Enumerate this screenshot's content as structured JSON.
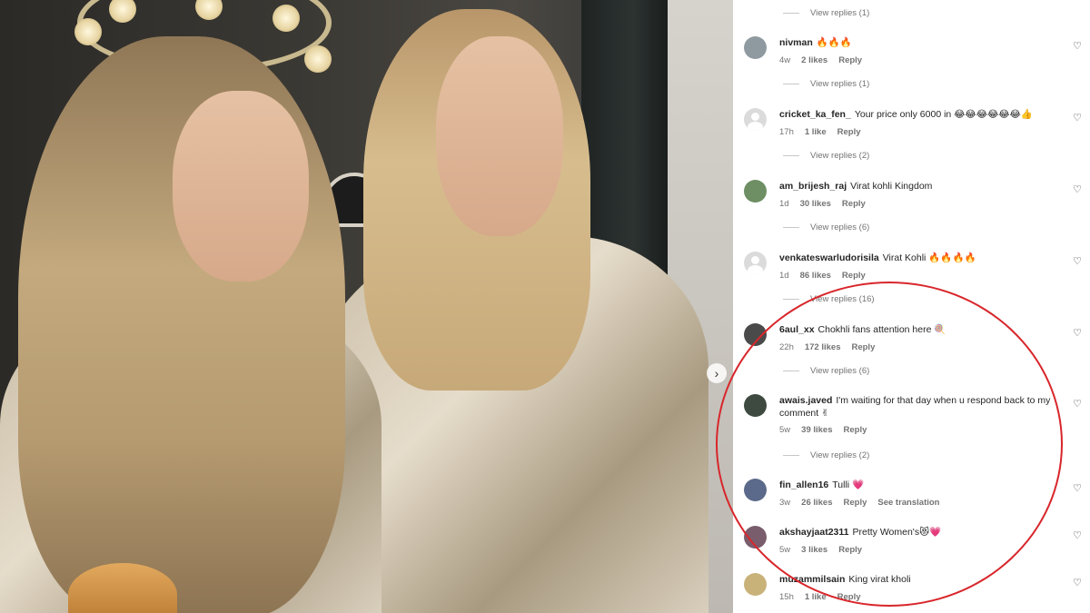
{
  "post": {
    "next_arrow": "›"
  },
  "comments": [
    {
      "type": "view_replies",
      "text": "View replies (1)"
    },
    {
      "username": "nivman",
      "text": "🔥🔥🔥",
      "age": "4w",
      "likes": "2 likes",
      "reply": "Reply",
      "avatar_color": "#8f9aa0"
    },
    {
      "type": "view_replies",
      "text": "View replies (1)"
    },
    {
      "username": "cricket_ka_fen_",
      "text": "Your price only 6000 in 😂😂😂😂😂😂👍",
      "age": "17h",
      "likes": "1 like",
      "reply": "Reply",
      "avatar_color": "generic"
    },
    {
      "type": "view_replies",
      "text": "View replies (2)"
    },
    {
      "username": "am_brijesh_raj",
      "text": "Virat kohli Kingdom",
      "age": "1d",
      "likes": "30 likes",
      "reply": "Reply",
      "avatar_color": "#6d8f63"
    },
    {
      "type": "view_replies",
      "text": "View replies (6)"
    },
    {
      "username": "venkateswarludorisila",
      "text": "Virat Kohli 🔥🔥🔥🔥",
      "age": "1d",
      "likes": "86 likes",
      "reply": "Reply",
      "avatar_color": "generic"
    },
    {
      "type": "view_replies",
      "text": "View replies (16)"
    },
    {
      "username": "6aul_xx",
      "text": "Chokhli fans attention here 🍭",
      "age": "22h",
      "likes": "172 likes",
      "reply": "Reply",
      "avatar_color": "#4a4a4a"
    },
    {
      "type": "view_replies",
      "text": "View replies (6)"
    },
    {
      "username": "awais.javed",
      "text": "I'm waiting for that day when u respond back to my comment ✌",
      "age": "5w",
      "likes": "39 likes",
      "reply": "Reply",
      "avatar_color": "#3e4a3f"
    },
    {
      "type": "view_replies",
      "text": "View replies (2)"
    },
    {
      "username": "fin_allen16",
      "text": "Tulli 💗",
      "age": "3w",
      "likes": "26 likes",
      "reply": "Reply",
      "translation": "See translation",
      "avatar_color": "#5b6a8a"
    },
    {
      "username": "akshayjaat2311",
      "text": "Pretty Women's😻💗",
      "age": "5w",
      "likes": "3 likes",
      "reply": "Reply",
      "avatar_color": "#7a5d6c"
    },
    {
      "username": "muzammilsain",
      "text": "King virat kholi",
      "age": "15h",
      "likes": "1 like",
      "reply": "Reply",
      "avatar_color": "#c9b27a"
    }
  ],
  "icons": {
    "heart": "♡"
  },
  "colors": {
    "annotation_circle": "#d8262b",
    "meta_gray": "#737373"
  }
}
